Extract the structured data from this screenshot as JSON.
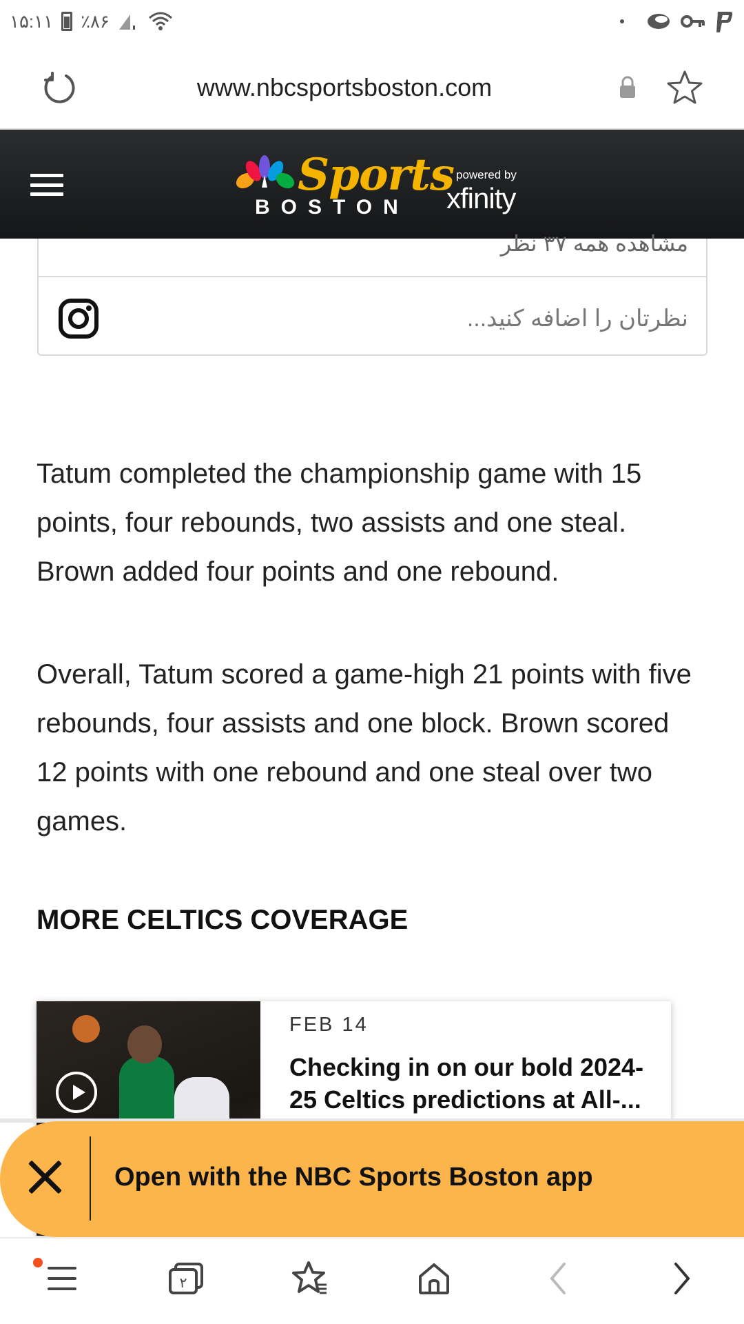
{
  "status_bar": {
    "time": "۱۵:۱۱",
    "battery": "٪۸۶"
  },
  "browser": {
    "url": "www.nbcsportsboston.com"
  },
  "site_header": {
    "logo_sports": "Sports",
    "logo_boston": "BOSTON",
    "powered_by": "powered by",
    "xfinity": "xfinity"
  },
  "comments": {
    "view_all": "مشاهده همه ۳۷ نظر",
    "add_placeholder": "نظرتان را اضافه کنید..."
  },
  "article": {
    "paragraphs": [
      "Tatum completed the championship game with 15 points, four rebounds, two assists and one steal. Brown added four points and one rebound.",
      "Overall, Tatum scored a game-high 21 points with five rebounds, four assists and one block. Brown scored 12 points with one rebound and one steal over two games."
    ],
    "section_heading": "MORE CELTICS COVERAGE"
  },
  "related": [
    {
      "date": "FEB  14",
      "title": "Checking in on our bold 2024-25 Celtics predictions at All-..."
    }
  ],
  "app_banner": {
    "text": "Open with the NBC Sports Boston app"
  },
  "bottom_nav": {
    "tab_count": "۲"
  },
  "colors": {
    "header_bg": "#1f2022",
    "banner_bg": "#fcb54a",
    "sports_gold": "#f4b400",
    "notif_dot": "#f4511e"
  }
}
